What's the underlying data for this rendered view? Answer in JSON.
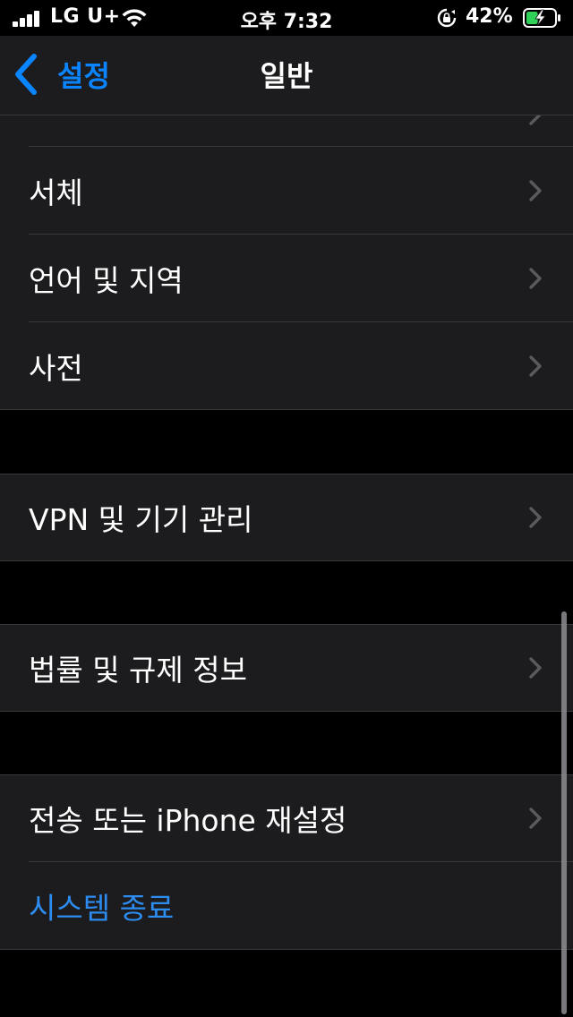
{
  "status_bar": {
    "carrier": "LG U+",
    "time": "오후 7:32",
    "battery_percent": "42%",
    "battery_level": 0.42,
    "battery_state": "charging",
    "icons": [
      "signal-icon",
      "wifi-icon",
      "rotation-lock-icon",
      "battery-charging-icon"
    ]
  },
  "nav": {
    "back_label": "설정",
    "title": "일반"
  },
  "groups": [
    {
      "rows": [
        {
          "label": "",
          "partial": true
        },
        {
          "label": "서체"
        },
        {
          "label": "언어 및 지역"
        },
        {
          "label": "사전"
        }
      ]
    },
    {
      "rows": [
        {
          "label": "VPN 및 기기 관리"
        }
      ]
    },
    {
      "rows": [
        {
          "label": "법률 및 규제 정보"
        }
      ]
    },
    {
      "rows": [
        {
          "label": "전송 또는 iPhone 재설정"
        },
        {
          "label": "시스템 종료",
          "style": "link"
        }
      ]
    }
  ],
  "colors": {
    "background": "#000000",
    "cell": "#1c1c1e",
    "separator": "#38383a",
    "accent": "#0a84ff",
    "chevron": "#5a5a5e"
  }
}
